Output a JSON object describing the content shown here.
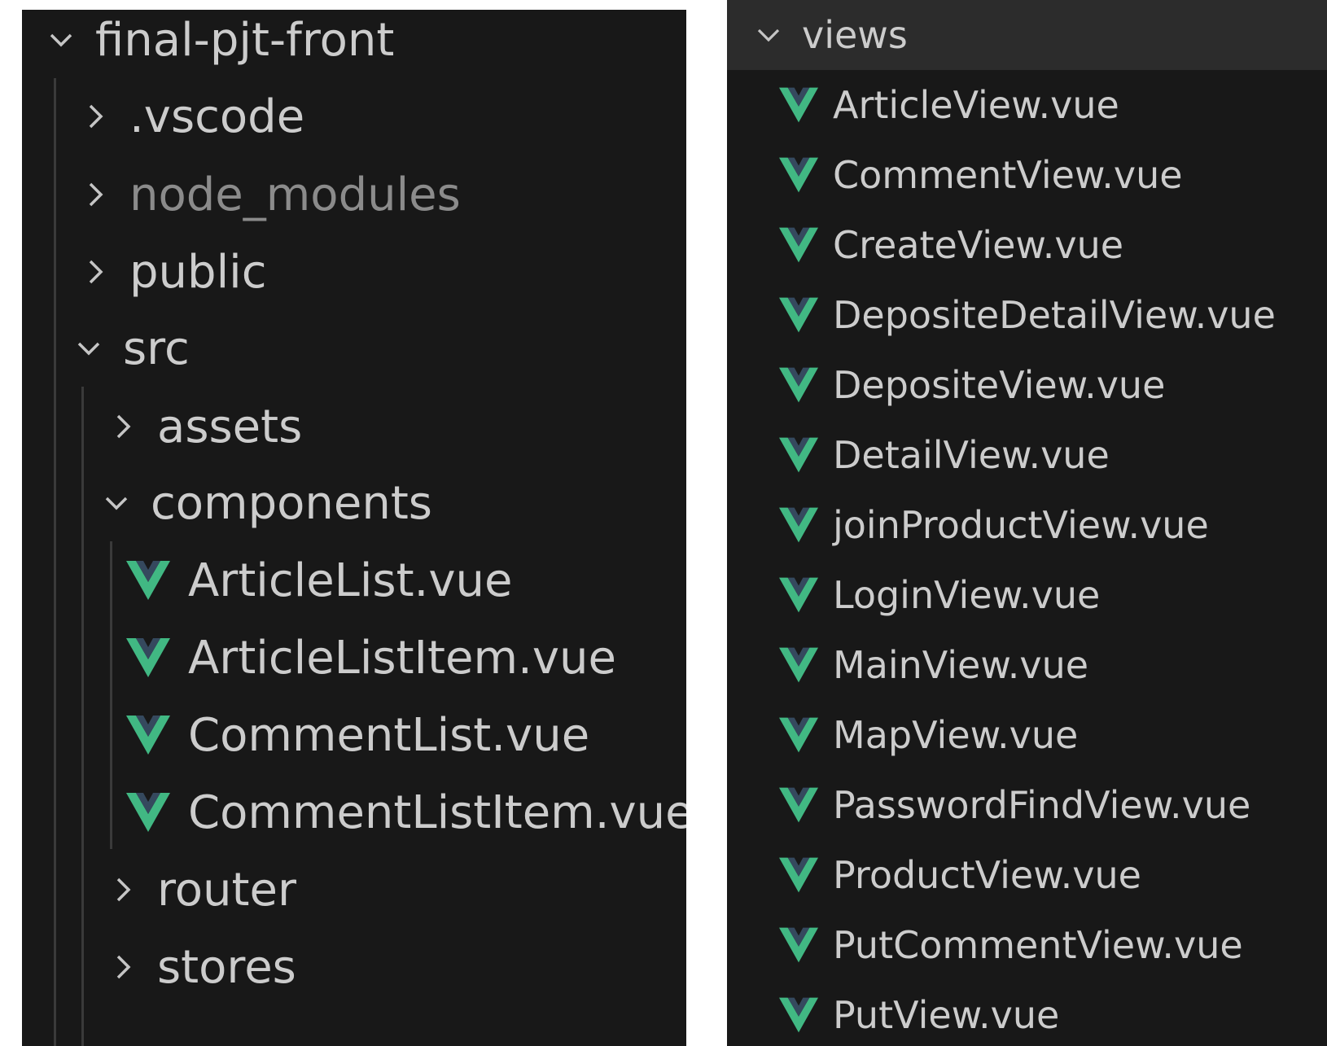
{
  "colors": {
    "panel_bg": "#181818",
    "header_bg": "#2c2c2c",
    "text": "#cccccc",
    "text_dim": "#8b8b8b",
    "vue_green": "#41b883",
    "vue_dark": "#35495e",
    "chevron": "#c5c5c5"
  },
  "explorer_left": {
    "items": [
      {
        "label": "final-pjt-front",
        "icon": "chevron-down-icon"
      },
      {
        "label": ".vscode",
        "icon": "chevron-right-icon"
      },
      {
        "label": "node_modules",
        "icon": "chevron-right-icon"
      },
      {
        "label": "public",
        "icon": "chevron-right-icon"
      },
      {
        "label": "src",
        "icon": "chevron-down-icon"
      },
      {
        "label": "assets",
        "icon": "chevron-right-icon"
      },
      {
        "label": "components",
        "icon": "chevron-down-icon"
      },
      {
        "label": "ArticleList.vue",
        "icon": "vue-icon"
      },
      {
        "label": "ArticleListItem.vue",
        "icon": "vue-icon"
      },
      {
        "label": "CommentList.vue",
        "icon": "vue-icon"
      },
      {
        "label": "CommentListItem.vue",
        "icon": "vue-icon"
      },
      {
        "label": "router",
        "icon": "chevron-right-icon"
      },
      {
        "label": "stores",
        "icon": "chevron-right-icon"
      }
    ]
  },
  "explorer_right": {
    "folder": {
      "label": "views",
      "icon": "chevron-down-icon"
    },
    "files": [
      {
        "label": "ArticleView.vue",
        "icon": "vue-icon"
      },
      {
        "label": "CommentView.vue",
        "icon": "vue-icon"
      },
      {
        "label": "CreateView.vue",
        "icon": "vue-icon"
      },
      {
        "label": "DepositeDetailView.vue",
        "icon": "vue-icon"
      },
      {
        "label": "DepositeView.vue",
        "icon": "vue-icon"
      },
      {
        "label": "DetailView.vue",
        "icon": "vue-icon"
      },
      {
        "label": "joinProductView.vue",
        "icon": "vue-icon"
      },
      {
        "label": "LoginView.vue",
        "icon": "vue-icon"
      },
      {
        "label": "MainView.vue",
        "icon": "vue-icon"
      },
      {
        "label": "MapView.vue",
        "icon": "vue-icon"
      },
      {
        "label": "PasswordFindView.vue",
        "icon": "vue-icon"
      },
      {
        "label": "ProductView.vue",
        "icon": "vue-icon"
      },
      {
        "label": "PutCommentView.vue",
        "icon": "vue-icon"
      },
      {
        "label": "PutView.vue",
        "icon": "vue-icon"
      }
    ]
  }
}
